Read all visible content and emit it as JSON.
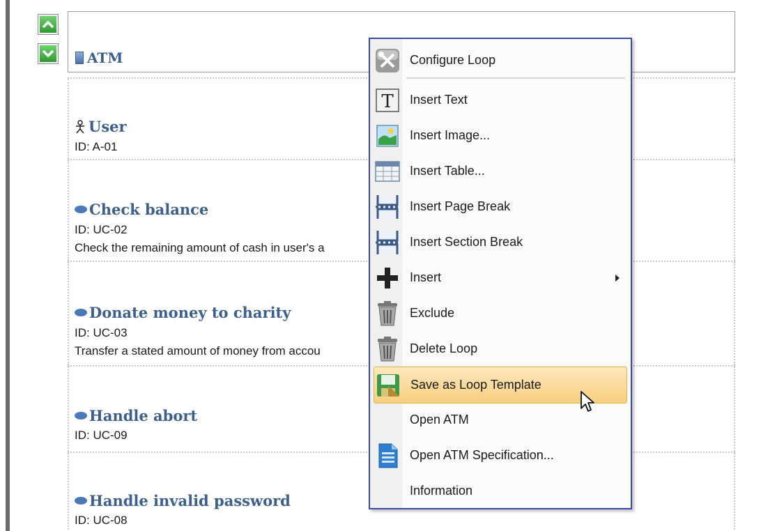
{
  "header": {
    "title": "ATM"
  },
  "items": [
    {
      "kind": "actor",
      "name": "User",
      "id": "ID: A-01",
      "desc": ""
    },
    {
      "kind": "usecase",
      "name": "Check balance",
      "id": "ID: UC-02",
      "desc": "Check the remaining amount of cash in user's a"
    },
    {
      "kind": "usecase",
      "name": "Donate money to charity",
      "id": "ID: UC-03",
      "desc": "Transfer a stated amount of money from accou"
    },
    {
      "kind": "usecase",
      "name": "Handle abort",
      "id": "ID: UC-09",
      "desc": ""
    },
    {
      "kind": "usecase",
      "name": "Handle invalid password",
      "id": "ID: UC-08",
      "desc": ""
    }
  ],
  "context_menu": {
    "items": [
      {
        "label": "Configure Loop",
        "icon": "wrench-screwdriver-icon"
      },
      {
        "label": "Insert Text",
        "icon": "text-icon"
      },
      {
        "label": "Insert Image...",
        "icon": "image-icon"
      },
      {
        "label": "Insert Table...",
        "icon": "table-icon"
      },
      {
        "label": "Insert Page Break",
        "icon": "page-break-icon"
      },
      {
        "label": "Insert Section Break",
        "icon": "section-break-icon"
      },
      {
        "label": "Insert",
        "icon": "plus-icon",
        "submenu": true
      },
      {
        "label": "Exclude",
        "icon": "trash-icon"
      },
      {
        "label": "Delete Loop",
        "icon": "trash-icon"
      },
      {
        "label": "Save as Loop Template",
        "icon": "save-template-icon",
        "highlighted": true
      },
      {
        "label": "Open ATM",
        "icon": ""
      },
      {
        "label": "Open ATM Specification...",
        "icon": "document-icon"
      },
      {
        "label": "Information",
        "icon": ""
      }
    ]
  },
  "colors": {
    "title": "#3c5f8e",
    "highlight": "#f8cf7f",
    "menu_border": "#3b4aa5"
  }
}
